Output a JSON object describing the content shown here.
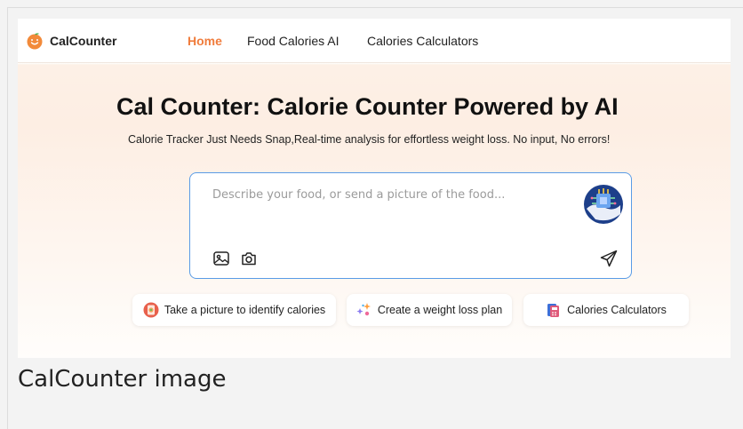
{
  "brand": {
    "name": "CalCounter"
  },
  "nav": {
    "items": [
      {
        "label": "Home",
        "active": true
      },
      {
        "label": "Food Calories AI",
        "active": false
      },
      {
        "label": "Calories Calculators",
        "active": false
      }
    ]
  },
  "hero": {
    "title": "Cal Counter: Calorie Counter Powered by AI",
    "subtitle": "Calorie Tracker Just Needs Snap,Real-time analysis for effortless weight loss. No input, No errors!"
  },
  "chat": {
    "placeholder": "Describe your food, or send a picture of the food...",
    "icons": [
      "image-icon",
      "camera-icon",
      "send-icon",
      "ai-robot-avatar"
    ]
  },
  "chips": [
    {
      "label": "Take a picture to identify calories",
      "icon": "food-photo-icon"
    },
    {
      "label": "Create a weight loss plan",
      "icon": "sparkle-plan-icon"
    },
    {
      "label": "Calories Calculators",
      "icon": "calculator-book-icon"
    }
  ],
  "caption": "CalCounter image",
  "colors": {
    "accent": "#f07c3c",
    "input_border": "#5a9ce6",
    "page_bg": "#f3f3f3"
  }
}
